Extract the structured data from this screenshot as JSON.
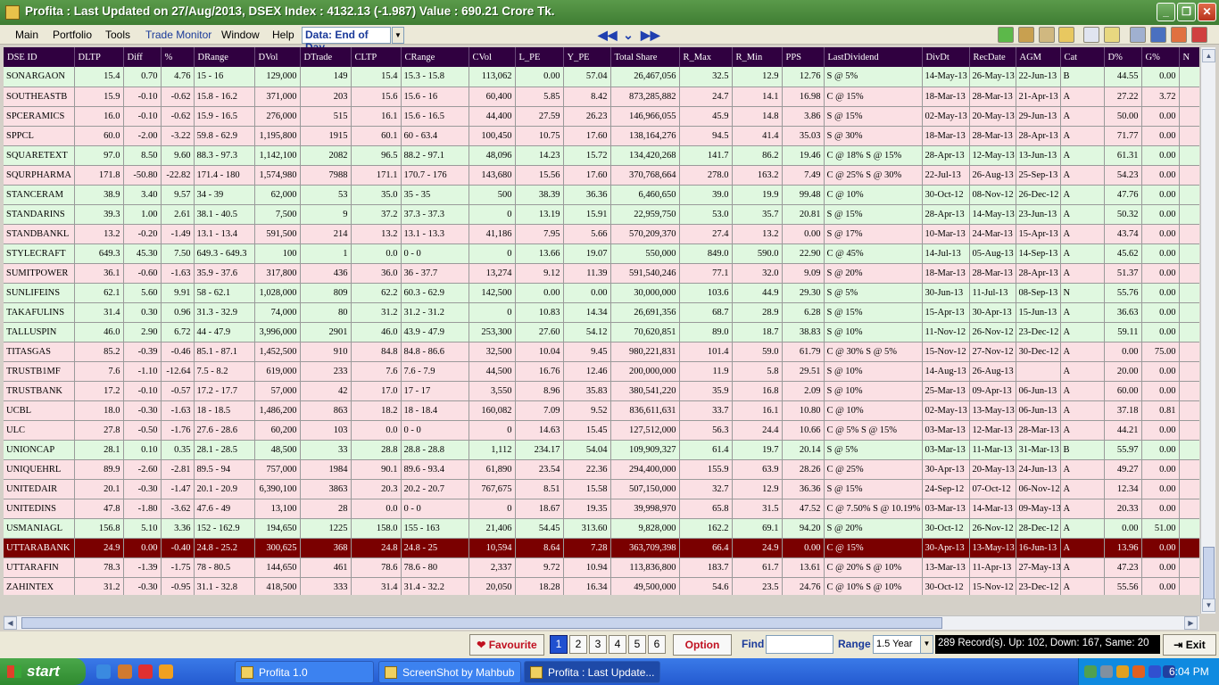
{
  "window": {
    "title": "Profita : Last Updated on 27/Aug/2013,  DSEX Index : 4132.13 (-1.987)  Value : 690.21 Crore Tk."
  },
  "menu": {
    "items": [
      "Main",
      "Portfolio",
      "Tools",
      "Trade Monitor",
      "Window",
      "Help"
    ],
    "data_mode": "Data: End of Day"
  },
  "columns": [
    "DSE ID",
    "DLTP",
    "Diff",
    "%",
    "DRange",
    "DVol",
    "DTrade",
    "CLTP",
    "CRange",
    "CVol",
    "L_PE",
    "Y_PE",
    "Total Share",
    "R_Max",
    "R_Min",
    "PPS",
    "LastDividend",
    "DivDt",
    "RecDate",
    "AGM",
    "Cat",
    "D%",
    "G%",
    "N"
  ],
  "rows": [
    {
      "status": "g",
      "cells": [
        "SONARGAON",
        "15.4",
        "0.70",
        "4.76",
        "15 - 16",
        "129,000",
        "149",
        "15.4",
        "15.3 - 15.8",
        "113,062",
        "0.00",
        "57.04",
        "26,467,056",
        "32.5",
        "12.9",
        "12.76",
        "S @ 5%",
        "14-May-13",
        "26-May-13",
        "22-Jun-13",
        "B",
        "44.55",
        "0.00",
        ""
      ]
    },
    {
      "status": "p",
      "cells": [
        "SOUTHEASTB",
        "15.9",
        "-0.10",
        "-0.62",
        "15.8 - 16.2",
        "371,000",
        "203",
        "15.6",
        "15.6 - 16",
        "60,400",
        "5.85",
        "8.42",
        "873,285,882",
        "24.7",
        "14.1",
        "16.98",
        "C @ 15%",
        "18-Mar-13",
        "28-Mar-13",
        "21-Apr-13",
        "A",
        "27.22",
        "3.72",
        ""
      ]
    },
    {
      "status": "p",
      "cells": [
        "SPCERAMICS",
        "16.0",
        "-0.10",
        "-0.62",
        "15.9 - 16.5",
        "276,000",
        "515",
        "16.1",
        "15.6 - 16.5",
        "44,400",
        "27.59",
        "26.23",
        "146,966,055",
        "45.9",
        "14.8",
        "3.86",
        "S @ 15%",
        "02-May-13",
        "20-May-13",
        "29-Jun-13",
        "A",
        "50.00",
        "0.00",
        ""
      ]
    },
    {
      "status": "p",
      "cells": [
        "SPPCL",
        "60.0",
        "-2.00",
        "-3.22",
        "59.8 - 62.9",
        "1,195,800",
        "1915",
        "60.1",
        "60 - 63.4",
        "100,450",
        "10.75",
        "17.60",
        "138,164,276",
        "94.5",
        "41.4",
        "35.03",
        "S @ 30%",
        "18-Mar-13",
        "28-Mar-13",
        "28-Apr-13",
        "A",
        "71.77",
        "0.00",
        ""
      ]
    },
    {
      "status": "g",
      "cells": [
        "SQUARETEXT",
        "97.0",
        "8.50",
        "9.60",
        "88.3 - 97.3",
        "1,142,100",
        "2082",
        "96.5",
        "88.2 - 97.1",
        "48,096",
        "14.23",
        "15.72",
        "134,420,268",
        "141.7",
        "86.2",
        "19.46",
        "C @ 18% S @ 15%",
        "28-Apr-13",
        "12-May-13",
        "13-Jun-13",
        "A",
        "61.31",
        "0.00",
        ""
      ]
    },
    {
      "status": "p",
      "cells": [
        "SQURPHARMA",
        "171.8",
        "-50.80",
        "-22.82",
        "171.4 - 180",
        "1,574,980",
        "7988",
        "171.1",
        "170.7 - 176",
        "143,680",
        "15.56",
        "17.60",
        "370,768,664",
        "278.0",
        "163.2",
        "7.49",
        "C @ 25% S @ 30%",
        "22-Jul-13",
        "26-Aug-13",
        "25-Sep-13",
        "A",
        "54.23",
        "0.00",
        ""
      ]
    },
    {
      "status": "g",
      "cells": [
        "STANCERAM",
        "38.9",
        "3.40",
        "9.57",
        "34 - 39",
        "62,000",
        "53",
        "35.0",
        "35 - 35",
        "500",
        "38.39",
        "36.36",
        "6,460,650",
        "39.0",
        "19.9",
        "99.48",
        "C @ 10%",
        "30-Oct-12",
        "08-Nov-12",
        "26-Dec-12",
        "A",
        "47.76",
        "0.00",
        ""
      ]
    },
    {
      "status": "g",
      "cells": [
        "STANDARINS",
        "39.3",
        "1.00",
        "2.61",
        "38.1 - 40.5",
        "7,500",
        "9",
        "37.2",
        "37.3 - 37.3",
        "0",
        "13.19",
        "15.91",
        "22,959,750",
        "53.0",
        "35.7",
        "20.81",
        "S @ 15%",
        "28-Apr-13",
        "14-May-13",
        "23-Jun-13",
        "A",
        "50.32",
        "0.00",
        ""
      ]
    },
    {
      "status": "p",
      "cells": [
        "STANDBANKL",
        "13.2",
        "-0.20",
        "-1.49",
        "13.1 - 13.4",
        "591,500",
        "214",
        "13.2",
        "13.1 - 13.3",
        "41,186",
        "7.95",
        "5.66",
        "570,209,370",
        "27.4",
        "13.2",
        "0.00",
        "S @ 17%",
        "10-Mar-13",
        "24-Mar-13",
        "15-Apr-13",
        "A",
        "43.74",
        "0.00",
        ""
      ]
    },
    {
      "status": "g",
      "cells": [
        "STYLECRAFT",
        "649.3",
        "45.30",
        "7.50",
        "649.3 - 649.3",
        "100",
        "1",
        "0.0",
        "0 - 0",
        "0",
        "13.66",
        "19.07",
        "550,000",
        "849.0",
        "590.0",
        "22.90",
        "C @ 45%",
        "14-Jul-13",
        "05-Aug-13",
        "14-Sep-13",
        "A",
        "45.62",
        "0.00",
        ""
      ]
    },
    {
      "status": "p",
      "cells": [
        "SUMITPOWER",
        "36.1",
        "-0.60",
        "-1.63",
        "35.9 - 37.6",
        "317,800",
        "436",
        "36.0",
        "36 - 37.7",
        "13,274",
        "9.12",
        "11.39",
        "591,540,246",
        "77.1",
        "32.0",
        "9.09",
        "S @ 20%",
        "18-Mar-13",
        "28-Mar-13",
        "28-Apr-13",
        "A",
        "51.37",
        "0.00",
        ""
      ]
    },
    {
      "status": "g",
      "cells": [
        "SUNLIFEINS",
        "62.1",
        "5.60",
        "9.91",
        "58 - 62.1",
        "1,028,000",
        "809",
        "62.2",
        "60.3 - 62.9",
        "142,500",
        "0.00",
        "0.00",
        "30,000,000",
        "103.6",
        "44.9",
        "29.30",
        "S @ 5%",
        "30-Jun-13",
        "11-Jul-13",
        "08-Sep-13",
        "N",
        "55.76",
        "0.00",
        ""
      ]
    },
    {
      "status": "g",
      "cells": [
        "TAKAFULINS",
        "31.4",
        "0.30",
        "0.96",
        "31.3 - 32.9",
        "74,000",
        "80",
        "31.2",
        "31.2 - 31.2",
        "0",
        "10.83",
        "14.34",
        "26,691,356",
        "68.7",
        "28.9",
        "6.28",
        "S @ 15%",
        "15-Apr-13",
        "30-Apr-13",
        "15-Jun-13",
        "A",
        "36.63",
        "0.00",
        ""
      ]
    },
    {
      "status": "g",
      "cells": [
        "TALLUSPIN",
        "46.0",
        "2.90",
        "6.72",
        "44 - 47.9",
        "3,996,000",
        "2901",
        "46.0",
        "43.9 - 47.9",
        "253,300",
        "27.60",
        "54.12",
        "70,620,851",
        "89.0",
        "18.7",
        "38.83",
        "S @ 10%",
        "11-Nov-12",
        "26-Nov-12",
        "23-Dec-12",
        "A",
        "59.11",
        "0.00",
        ""
      ]
    },
    {
      "status": "p",
      "cells": [
        "TITASGAS",
        "85.2",
        "-0.39",
        "-0.46",
        "85.1 - 87.1",
        "1,452,500",
        "910",
        "84.8",
        "84.8 - 86.6",
        "32,500",
        "10.04",
        "9.45",
        "980,221,831",
        "101.4",
        "59.0",
        "61.79",
        "C @ 30% S @ 5%",
        "15-Nov-12",
        "27-Nov-12",
        "30-Dec-12",
        "A",
        "0.00",
        "75.00",
        ""
      ]
    },
    {
      "status": "p",
      "cells": [
        "TRUSTB1MF",
        "7.6",
        "-1.10",
        "-12.64",
        "7.5 - 8.2",
        "619,000",
        "233",
        "7.6",
        "7.6 - 7.9",
        "44,500",
        "16.76",
        "12.46",
        "200,000,000",
        "11.9",
        "5.8",
        "29.51",
        "S @ 10%",
        "14-Aug-13",
        "26-Aug-13",
        "",
        "A",
        "20.00",
        "0.00",
        ""
      ]
    },
    {
      "status": "p",
      "cells": [
        "TRUSTBANK",
        "17.2",
        "-0.10",
        "-0.57",
        "17.2 - 17.7",
        "57,000",
        "42",
        "17.0",
        "17 - 17",
        "3,550",
        "8.96",
        "35.83",
        "380,541,220",
        "35.9",
        "16.8",
        "2.09",
        "S @ 10%",
        "25-Mar-13",
        "09-Apr-13",
        "06-Jun-13",
        "A",
        "60.00",
        "0.00",
        ""
      ]
    },
    {
      "status": "p",
      "cells": [
        "UCBL",
        "18.0",
        "-0.30",
        "-1.63",
        "18 - 18.5",
        "1,486,200",
        "863",
        "18.2",
        "18 - 18.4",
        "160,082",
        "7.09",
        "9.52",
        "836,611,631",
        "33.7",
        "16.1",
        "10.80",
        "C @ 10%",
        "02-May-13",
        "13-May-13",
        "06-Jun-13",
        "A",
        "37.18",
        "0.81",
        ""
      ]
    },
    {
      "status": "p",
      "cells": [
        "ULC",
        "27.8",
        "-0.50",
        "-1.76",
        "27.6 - 28.6",
        "60,200",
        "103",
        "0.0",
        "0 - 0",
        "0",
        "14.63",
        "15.45",
        "127,512,000",
        "56.3",
        "24.4",
        "10.66",
        "C @ 5% S @ 15%",
        "03-Mar-13",
        "12-Mar-13",
        "28-Mar-13",
        "A",
        "44.21",
        "0.00",
        ""
      ]
    },
    {
      "status": "g",
      "cells": [
        "UNIONCAP",
        "28.1",
        "0.10",
        "0.35",
        "28.1 - 28.5",
        "48,500",
        "33",
        "28.8",
        "28.8 - 28.8",
        "1,112",
        "234.17",
        "54.04",
        "109,909,327",
        "61.4",
        "19.7",
        "20.14",
        "S @ 5%",
        "03-Mar-13",
        "11-Mar-13",
        "31-Mar-13",
        "B",
        "55.97",
        "0.00",
        ""
      ]
    },
    {
      "status": "p",
      "cells": [
        "UNIQUEHRL",
        "89.9",
        "-2.60",
        "-2.81",
        "89.5 - 94",
        "757,000",
        "1984",
        "90.1",
        "89.6 - 93.4",
        "61,890",
        "23.54",
        "22.36",
        "294,400,000",
        "155.9",
        "63.9",
        "28.26",
        "C @ 25%",
        "30-Apr-13",
        "20-May-13",
        "24-Jun-13",
        "A",
        "49.27",
        "0.00",
        ""
      ]
    },
    {
      "status": "p",
      "cells": [
        "UNITEDAIR",
        "20.1",
        "-0.30",
        "-1.47",
        "20.1 - 20.9",
        "6,390,100",
        "3863",
        "20.3",
        "20.2 - 20.7",
        "767,675",
        "8.51",
        "15.58",
        "507,150,000",
        "32.7",
        "12.9",
        "36.36",
        "S @ 15%",
        "24-Sep-12",
        "07-Oct-12",
        "06-Nov-12",
        "A",
        "12.34",
        "0.00",
        ""
      ]
    },
    {
      "status": "p",
      "cells": [
        "UNITEDINS",
        "47.8",
        "-1.80",
        "-3.62",
        "47.6 - 49",
        "13,100",
        "28",
        "0.0",
        "0 - 0",
        "0",
        "18.67",
        "19.35",
        "39,998,970",
        "65.8",
        "31.5",
        "47.52",
        "C @ 7.50% S @ 10.19%",
        "03-Mar-13",
        "14-Mar-13",
        "09-May-13",
        "A",
        "20.33",
        "0.00",
        ""
      ]
    },
    {
      "status": "g",
      "cells": [
        "USMANIAGL",
        "156.8",
        "5.10",
        "3.36",
        "152 - 162.9",
        "194,650",
        "1225",
        "158.0",
        "155 - 163",
        "21,406",
        "54.45",
        "313.60",
        "9,828,000",
        "162.2",
        "69.1",
        "94.20",
        "S @ 20%",
        "30-Oct-12",
        "26-Nov-12",
        "28-Dec-12",
        "A",
        "0.00",
        "51.00",
        ""
      ]
    },
    {
      "status": "s",
      "cells": [
        "UTTARABANK",
        "24.9",
        "0.00",
        "-0.40",
        "24.8 - 25.2",
        "300,625",
        "368",
        "24.8",
        "24.8 - 25",
        "10,594",
        "8.64",
        "7.28",
        "363,709,398",
        "66.4",
        "24.9",
        "0.00",
        "C @ 15%",
        "30-Apr-13",
        "13-May-13",
        "16-Jun-13",
        "A",
        "13.96",
        "0.00",
        ""
      ]
    },
    {
      "status": "p",
      "cells": [
        "UTTARAFIN",
        "78.3",
        "-1.39",
        "-1.75",
        "78 - 80.5",
        "144,650",
        "461",
        "78.6",
        "78.6 - 80",
        "2,337",
        "9.72",
        "10.94",
        "113,836,800",
        "183.7",
        "61.7",
        "13.61",
        "C @ 20% S @ 10%",
        "13-Mar-13",
        "11-Apr-13",
        "27-May-13",
        "A",
        "47.23",
        "0.00",
        ""
      ]
    },
    {
      "status": "p",
      "cells": [
        "ZAHINTEX",
        "31.2",
        "-0.30",
        "-0.95",
        "31.1 - 32.8",
        "418,500",
        "333",
        "31.4",
        "31.4 - 32.2",
        "20,050",
        "18.28",
        "16.34",
        "49,500,000",
        "54.6",
        "23.5",
        "24.76",
        "C @ 10% S @ 10%",
        "30-Oct-12",
        "15-Nov-12",
        "23-Dec-12",
        "A",
        "55.56",
        "0.00",
        ""
      ]
    }
  ],
  "status_bar": {
    "favourite": "Favourite",
    "pages": [
      "1",
      "2",
      "3",
      "4",
      "5",
      "6"
    ],
    "active_page": "1",
    "option": "Option",
    "find_label": "Find",
    "find_value": "",
    "range_label": "Range",
    "range_value": "1.5 Year",
    "record_summary": "289 Record(s). Up: 102, Down: 167, Same: 20",
    "exit": "Exit"
  },
  "taskbar": {
    "start": "start",
    "tasks": [
      "Profita 1.0",
      "ScreenShot by Mahbub",
      "Profita : Last Update..."
    ],
    "clock": "6:04 PM"
  },
  "colors": {
    "header_bg": "#300040",
    "row_up": "#e0f8e0",
    "row_down": "#fbe0e4",
    "row_selected": "#7a0000",
    "title_bar": "#4a8a3c",
    "taskbar": "#245ad0"
  },
  "icons": [
    "app-icon",
    "minimize-icon",
    "restore-icon",
    "close-icon",
    "first-page-icon",
    "expand-icon",
    "last-page-icon",
    "heart-icon",
    "exit-icon",
    "windows-flag-icon"
  ]
}
